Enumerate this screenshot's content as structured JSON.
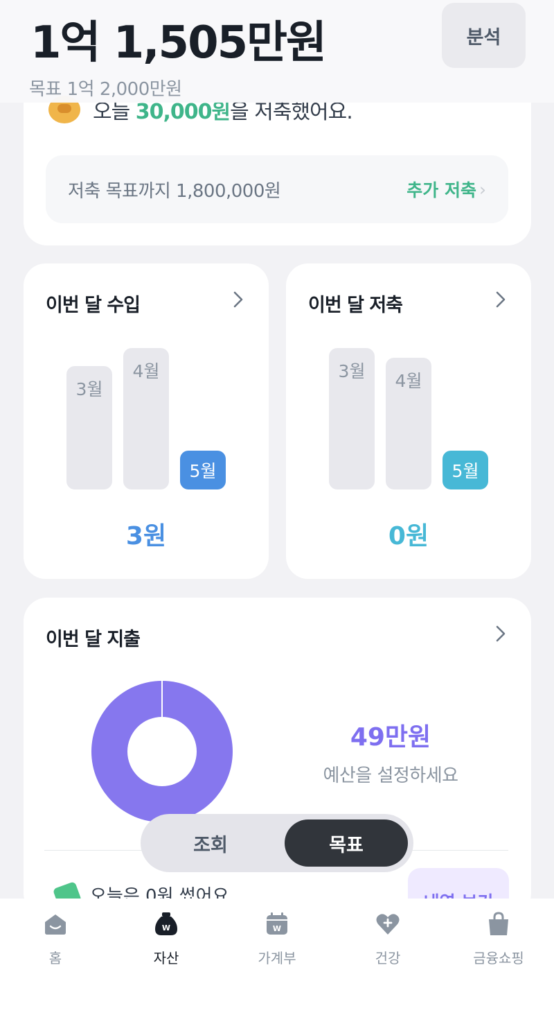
{
  "header": {
    "total": "1억 1,505만원",
    "goal": "목표 1억 2,000만원",
    "analysis_button": "분석"
  },
  "savings_card": {
    "message_prefix": "오늘",
    "message_amount": "30,000원",
    "message_suffix": "을 저축했어요.",
    "goal_remaining": "저축 목표까지 1,800,000원",
    "extra_saving": "추가 저축"
  },
  "income_card": {
    "title": "이번 달 수입",
    "months": [
      "3월",
      "4월",
      "5월"
    ],
    "amount": "3원",
    "accent": "#4a90e2"
  },
  "saving_card": {
    "title": "이번 달 저축",
    "months": [
      "3월",
      "4월",
      "5월"
    ],
    "amount": "0원",
    "accent": "#47b8d6"
  },
  "spending_card": {
    "title": "이번 달 지출",
    "amount": "49만원",
    "subtitle": "예산을 설정하세요",
    "today": "오늘은 0원 썼어요",
    "history_button": "내역 보기",
    "accent": "#8677ee"
  },
  "segmented": {
    "left": "조회",
    "right": "목표",
    "selected": "목표"
  },
  "tabs": [
    {
      "label": "홈",
      "icon": "home-icon"
    },
    {
      "label": "자산",
      "icon": "money-bag-icon",
      "active": true
    },
    {
      "label": "가계부",
      "icon": "calendar-icon"
    },
    {
      "label": "건강",
      "icon": "heart-plus-icon"
    },
    {
      "label": "금융쇼핑",
      "icon": "shopping-bag-icon"
    }
  ]
}
